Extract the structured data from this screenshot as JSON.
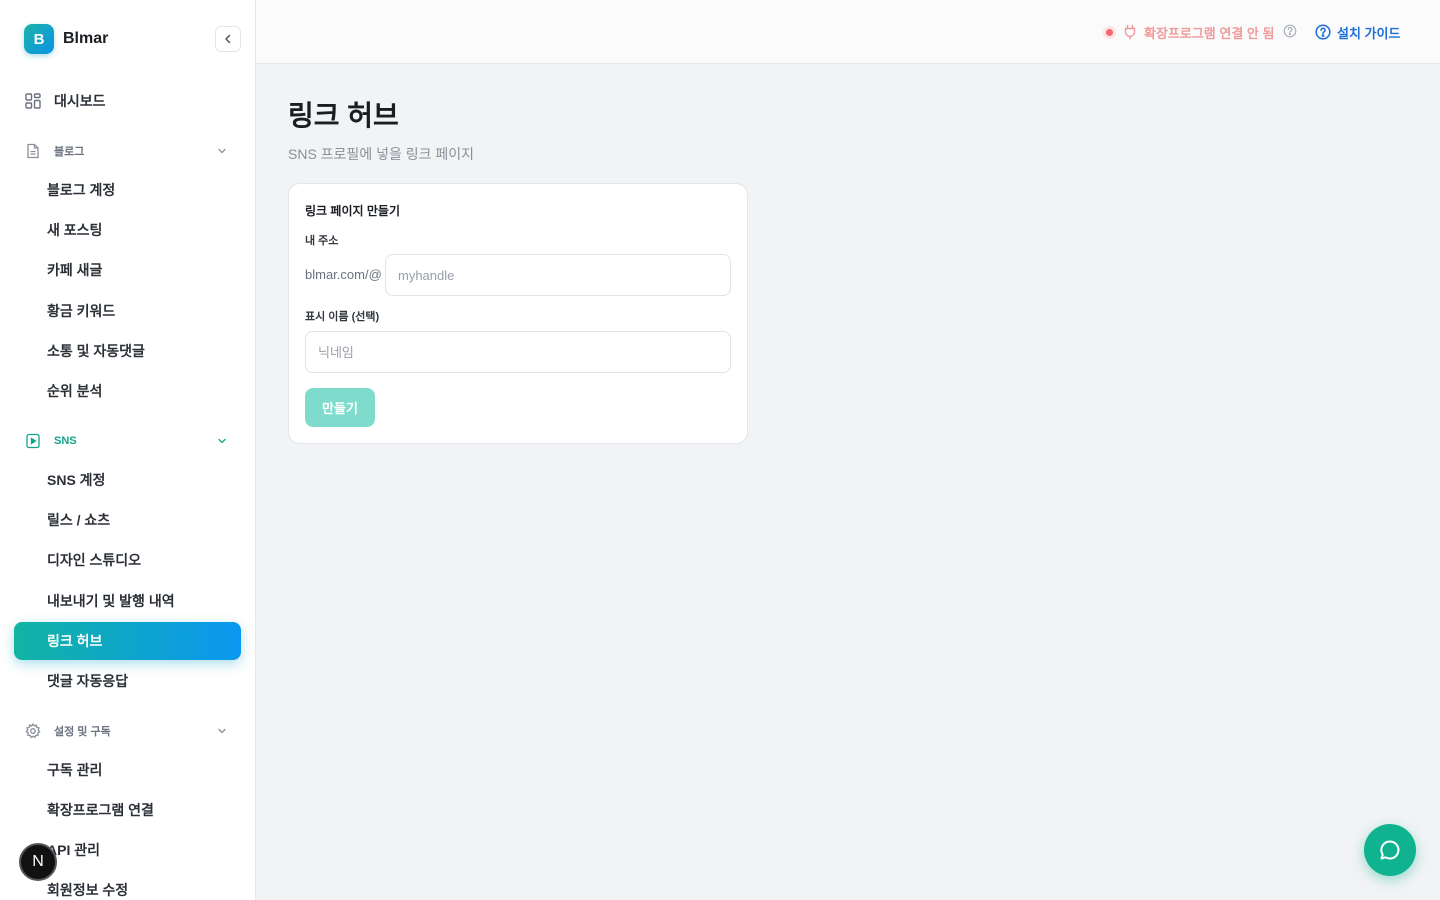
{
  "brand": {
    "logo_letter": "B",
    "name": "Blmar"
  },
  "sidebar": {
    "dashboard": "대시보드",
    "blog_section": "블로그",
    "blog_items": [
      "블로그 계정",
      "새 포스팅",
      "카페 새글",
      "황금 키워드",
      "소통 및 자동댓글",
      "순위 분석"
    ],
    "sns_section": "SNS",
    "sns_items": [
      "SNS 계정",
      "릴스 / 쇼츠",
      "디자인 스튜디오",
      "내보내기 및 발행 내역",
      "링크 허브",
      "댓글 자동응답"
    ],
    "settings_section": "설정 및 구독",
    "settings_items": [
      "구독 관리",
      "확장프로그램 연결",
      "API 관리",
      "회원정보 수정"
    ],
    "active_item": "링크 허브"
  },
  "badge": {
    "letter": "N"
  },
  "topbar": {
    "extension_status": "확장프로그램 연결 안 됨",
    "guide_label": "설치 가이드"
  },
  "page": {
    "title": "링크 허브",
    "subtitle": "SNS 프로필에 넣을 링크 페이지"
  },
  "card": {
    "title": "링크 페이지 만들기",
    "address_label": "내 주소",
    "address_prefix": "blmar.com/@",
    "address_placeholder": "myhandle",
    "display_name_label": "표시 이름 (선택)",
    "display_name_placeholder": "닉네임",
    "create_button": "만들기"
  },
  "colors": {
    "accent_start": "#13b3a2",
    "accent_end": "#0b97f0",
    "status_error": "#f5686a",
    "link_blue": "#1f6fd6",
    "button_disabled": "#7fdccd"
  }
}
